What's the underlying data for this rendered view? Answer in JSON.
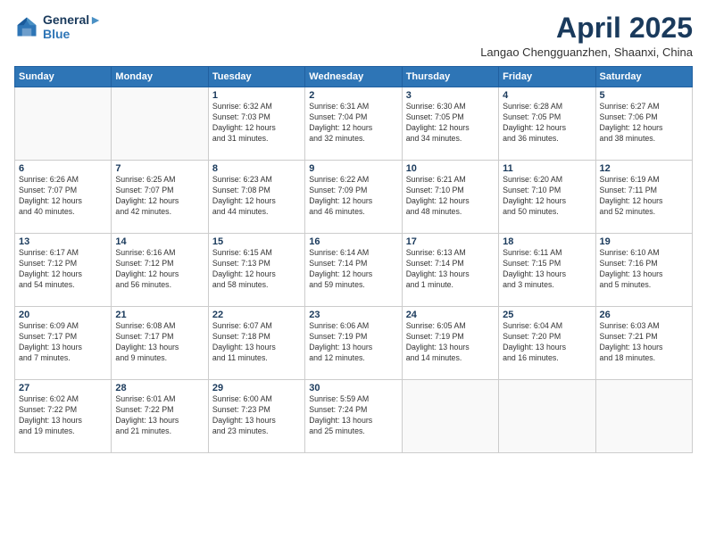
{
  "logo": {
    "line1": "General",
    "line2": "Blue"
  },
  "title": "April 2025",
  "location": "Langao Chengguanzhen, Shaanxi, China",
  "days_header": [
    "Sunday",
    "Monday",
    "Tuesday",
    "Wednesday",
    "Thursday",
    "Friday",
    "Saturday"
  ],
  "weeks": [
    [
      {
        "day": "",
        "info": ""
      },
      {
        "day": "",
        "info": ""
      },
      {
        "day": "1",
        "info": "Sunrise: 6:32 AM\nSunset: 7:03 PM\nDaylight: 12 hours\nand 31 minutes."
      },
      {
        "day": "2",
        "info": "Sunrise: 6:31 AM\nSunset: 7:04 PM\nDaylight: 12 hours\nand 32 minutes."
      },
      {
        "day": "3",
        "info": "Sunrise: 6:30 AM\nSunset: 7:05 PM\nDaylight: 12 hours\nand 34 minutes."
      },
      {
        "day": "4",
        "info": "Sunrise: 6:28 AM\nSunset: 7:05 PM\nDaylight: 12 hours\nand 36 minutes."
      },
      {
        "day": "5",
        "info": "Sunrise: 6:27 AM\nSunset: 7:06 PM\nDaylight: 12 hours\nand 38 minutes."
      }
    ],
    [
      {
        "day": "6",
        "info": "Sunrise: 6:26 AM\nSunset: 7:07 PM\nDaylight: 12 hours\nand 40 minutes."
      },
      {
        "day": "7",
        "info": "Sunrise: 6:25 AM\nSunset: 7:07 PM\nDaylight: 12 hours\nand 42 minutes."
      },
      {
        "day": "8",
        "info": "Sunrise: 6:23 AM\nSunset: 7:08 PM\nDaylight: 12 hours\nand 44 minutes."
      },
      {
        "day": "9",
        "info": "Sunrise: 6:22 AM\nSunset: 7:09 PM\nDaylight: 12 hours\nand 46 minutes."
      },
      {
        "day": "10",
        "info": "Sunrise: 6:21 AM\nSunset: 7:10 PM\nDaylight: 12 hours\nand 48 minutes."
      },
      {
        "day": "11",
        "info": "Sunrise: 6:20 AM\nSunset: 7:10 PM\nDaylight: 12 hours\nand 50 minutes."
      },
      {
        "day": "12",
        "info": "Sunrise: 6:19 AM\nSunset: 7:11 PM\nDaylight: 12 hours\nand 52 minutes."
      }
    ],
    [
      {
        "day": "13",
        "info": "Sunrise: 6:17 AM\nSunset: 7:12 PM\nDaylight: 12 hours\nand 54 minutes."
      },
      {
        "day": "14",
        "info": "Sunrise: 6:16 AM\nSunset: 7:12 PM\nDaylight: 12 hours\nand 56 minutes."
      },
      {
        "day": "15",
        "info": "Sunrise: 6:15 AM\nSunset: 7:13 PM\nDaylight: 12 hours\nand 58 minutes."
      },
      {
        "day": "16",
        "info": "Sunrise: 6:14 AM\nSunset: 7:14 PM\nDaylight: 12 hours\nand 59 minutes."
      },
      {
        "day": "17",
        "info": "Sunrise: 6:13 AM\nSunset: 7:14 PM\nDaylight: 13 hours\nand 1 minute."
      },
      {
        "day": "18",
        "info": "Sunrise: 6:11 AM\nSunset: 7:15 PM\nDaylight: 13 hours\nand 3 minutes."
      },
      {
        "day": "19",
        "info": "Sunrise: 6:10 AM\nSunset: 7:16 PM\nDaylight: 13 hours\nand 5 minutes."
      }
    ],
    [
      {
        "day": "20",
        "info": "Sunrise: 6:09 AM\nSunset: 7:17 PM\nDaylight: 13 hours\nand 7 minutes."
      },
      {
        "day": "21",
        "info": "Sunrise: 6:08 AM\nSunset: 7:17 PM\nDaylight: 13 hours\nand 9 minutes."
      },
      {
        "day": "22",
        "info": "Sunrise: 6:07 AM\nSunset: 7:18 PM\nDaylight: 13 hours\nand 11 minutes."
      },
      {
        "day": "23",
        "info": "Sunrise: 6:06 AM\nSunset: 7:19 PM\nDaylight: 13 hours\nand 12 minutes."
      },
      {
        "day": "24",
        "info": "Sunrise: 6:05 AM\nSunset: 7:19 PM\nDaylight: 13 hours\nand 14 minutes."
      },
      {
        "day": "25",
        "info": "Sunrise: 6:04 AM\nSunset: 7:20 PM\nDaylight: 13 hours\nand 16 minutes."
      },
      {
        "day": "26",
        "info": "Sunrise: 6:03 AM\nSunset: 7:21 PM\nDaylight: 13 hours\nand 18 minutes."
      }
    ],
    [
      {
        "day": "27",
        "info": "Sunrise: 6:02 AM\nSunset: 7:22 PM\nDaylight: 13 hours\nand 19 minutes."
      },
      {
        "day": "28",
        "info": "Sunrise: 6:01 AM\nSunset: 7:22 PM\nDaylight: 13 hours\nand 21 minutes."
      },
      {
        "day": "29",
        "info": "Sunrise: 6:00 AM\nSunset: 7:23 PM\nDaylight: 13 hours\nand 23 minutes."
      },
      {
        "day": "30",
        "info": "Sunrise: 5:59 AM\nSunset: 7:24 PM\nDaylight: 13 hours\nand 25 minutes."
      },
      {
        "day": "",
        "info": ""
      },
      {
        "day": "",
        "info": ""
      },
      {
        "day": "",
        "info": ""
      }
    ]
  ]
}
